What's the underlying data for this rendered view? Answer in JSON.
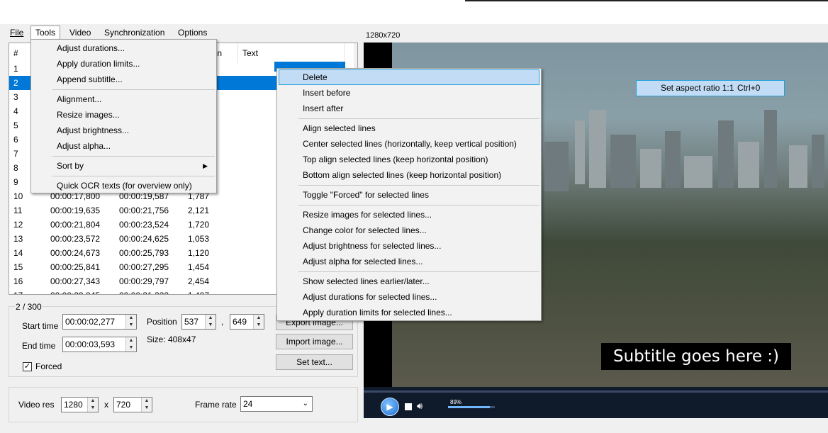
{
  "menubar": {
    "items": [
      {
        "label": "File",
        "active": false
      },
      {
        "label": "Tools",
        "active": true
      },
      {
        "label": "Video",
        "active": false
      },
      {
        "label": "Synchronization",
        "active": false
      },
      {
        "label": "Options",
        "active": false
      }
    ]
  },
  "tools_menu": {
    "items": [
      "Adjust durations...",
      "Apply duration limits...",
      "Append subtitle...",
      "Alignment...",
      "Resize images...",
      "Adjust brightness...",
      "Adjust alpha...",
      "Sort by",
      "Quick OCR texts (for overview only)"
    ]
  },
  "context_menu": {
    "items": [
      "Delete",
      "Insert before",
      "Insert after",
      "Align selected lines",
      "Center selected lines (horizontally, keep vertical position)",
      "Top align selected lines (keep horizontal position)",
      "Bottom align selected lines (keep horizontal position)",
      "Toggle \"Forced\" for selected lines",
      "Resize images for selected lines...",
      "Change color for selected lines...",
      "Adjust brightness for selected lines...",
      "Adjust alpha for selected lines...",
      "Show selected lines earlier/later...",
      "Adjust durations for selected lines...",
      "Apply duration limits for selected lines..."
    ],
    "highlighted": "Delete"
  },
  "video_context": {
    "label": "Set aspect ratio 1:1",
    "shortcut": "Ctrl+0"
  },
  "list": {
    "headers": {
      "num": "#",
      "duration": "n",
      "text": "Text"
    },
    "rows": [
      {
        "num": "1",
        "start": "",
        "end": "",
        "dur": ""
      },
      {
        "num": "2",
        "start": "",
        "end": "",
        "dur": ""
      },
      {
        "num": "3",
        "start": "",
        "end": "",
        "dur": ""
      },
      {
        "num": "4",
        "start": "",
        "end": "",
        "dur": ""
      },
      {
        "num": "5",
        "start": "",
        "end": "",
        "dur": ""
      },
      {
        "num": "6",
        "start": "",
        "end": "",
        "dur": ""
      },
      {
        "num": "7",
        "start": "",
        "end": "",
        "dur": ""
      },
      {
        "num": "8",
        "start": "",
        "end": "",
        "dur": ""
      },
      {
        "num": "9",
        "start": "",
        "end": "",
        "dur": ""
      },
      {
        "num": "10",
        "start": "00:00:17,800",
        "end": "00:00:19,587",
        "dur": "1,787"
      },
      {
        "num": "11",
        "start": "00:00:19,635",
        "end": "00:00:21,756",
        "dur": "2,121"
      },
      {
        "num": "12",
        "start": "00:00:21,804",
        "end": "00:00:23,524",
        "dur": "1,720"
      },
      {
        "num": "13",
        "start": "00:00:23,572",
        "end": "00:00:24,625",
        "dur": "1,053"
      },
      {
        "num": "14",
        "start": "00:00:24,673",
        "end": "00:00:25,793",
        "dur": "1,120"
      },
      {
        "num": "15",
        "start": "00:00:25,841",
        "end": "00:00:27,295",
        "dur": "1,454"
      },
      {
        "num": "16",
        "start": "00:00:27,343",
        "end": "00:00:29,797",
        "dur": "2,454"
      },
      {
        "num": "17",
        "start": "00:00:29,845",
        "end": "00:00:31,332",
        "dur": "1,487"
      }
    ],
    "selected_index": 1
  },
  "props": {
    "counter": "2 / 300",
    "start_label": "Start time",
    "start_value": "00:00:02,277",
    "end_label": "End time",
    "end_value": "00:00:03,593",
    "position_label": "Position",
    "pos_x": "537",
    "pos_sep": ",",
    "pos_y": "649",
    "size_text": "Size: 408x47",
    "forced_label": "Forced",
    "forced_checked": true,
    "export_button": "Export image...",
    "import_button": "Import image...",
    "settext_button": "Set text..."
  },
  "bottom": {
    "video_res_label": "Video res",
    "res_w": "1280",
    "res_x": "x",
    "res_h": "720",
    "frame_rate_label": "Frame rate",
    "frame_rate": "24"
  },
  "video": {
    "resolution_label": "1280x720",
    "subtitle": "Subtitle goes here :)",
    "volume_percent": "89%",
    "volume_fraction": 0.89
  }
}
